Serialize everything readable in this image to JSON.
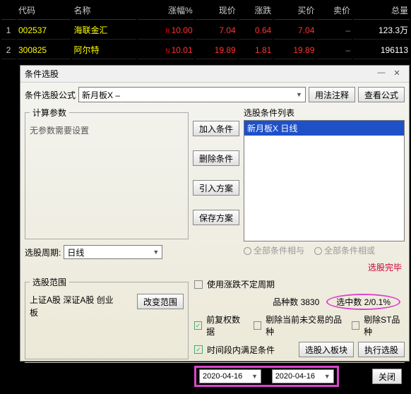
{
  "table": {
    "headers": [
      "",
      "代码",
      "名称",
      "涨幅%",
      "现价",
      "涨跌",
      "买价",
      "卖价",
      "总量"
    ],
    "rows": [
      {
        "idx": "1",
        "code": "002537",
        "name": "海联金汇",
        "badge": "R",
        "pct": "10.00",
        "price": "7.04",
        "chg": "0.64",
        "bid": "7.04",
        "ask": "–",
        "vol": "123.3万"
      },
      {
        "idx": "2",
        "code": "300825",
        "name": "阿尔特",
        "badge": "N",
        "pct": "10.01",
        "price": "19.89",
        "chg": "1.81",
        "bid": "19.89",
        "ask": "–",
        "vol": "196113"
      }
    ]
  },
  "dialog": {
    "title": "条件选股",
    "formula_label": "条件选股公式",
    "formula_value": "新月板X      –",
    "btn_usage": "用法注释",
    "btn_view": "查看公式",
    "params_legend": "计算参数",
    "no_params": "无参数需要设置",
    "btn_add": "加入条件",
    "btn_del": "删除条件",
    "btn_import": "引入方案",
    "btn_save": "保存方案",
    "period_label": "选股周期:",
    "period_value": "日线",
    "cond_list_label": "选股条件列表",
    "cond_item": "新月板X   日线",
    "radio_and": "全部条件相与",
    "radio_or": "全部条件相或",
    "status": "选股完毕",
    "range_legend": "选股范围",
    "range_text": "上证A股 深证A股 创业板",
    "btn_change_range": "改变范围",
    "chk_nofixed": "使用涨跌不定周期",
    "count_kinds_label": "品种数",
    "count_kinds": "3830",
    "count_sel_label": "选中数",
    "count_sel": "2/0.1%",
    "chk_adj": "前复权数据",
    "chk_remove_notrade": "剔除当前未交易的品种",
    "chk_remove_st": "剔除ST品种",
    "chk_time": "时间段内满足条件",
    "btn_toblock": "选股入板块",
    "btn_run": "执行选股",
    "date_from": "2020-04-16",
    "date_to": "2020-04-16",
    "date_sep": "–",
    "btn_close": "关闭"
  }
}
